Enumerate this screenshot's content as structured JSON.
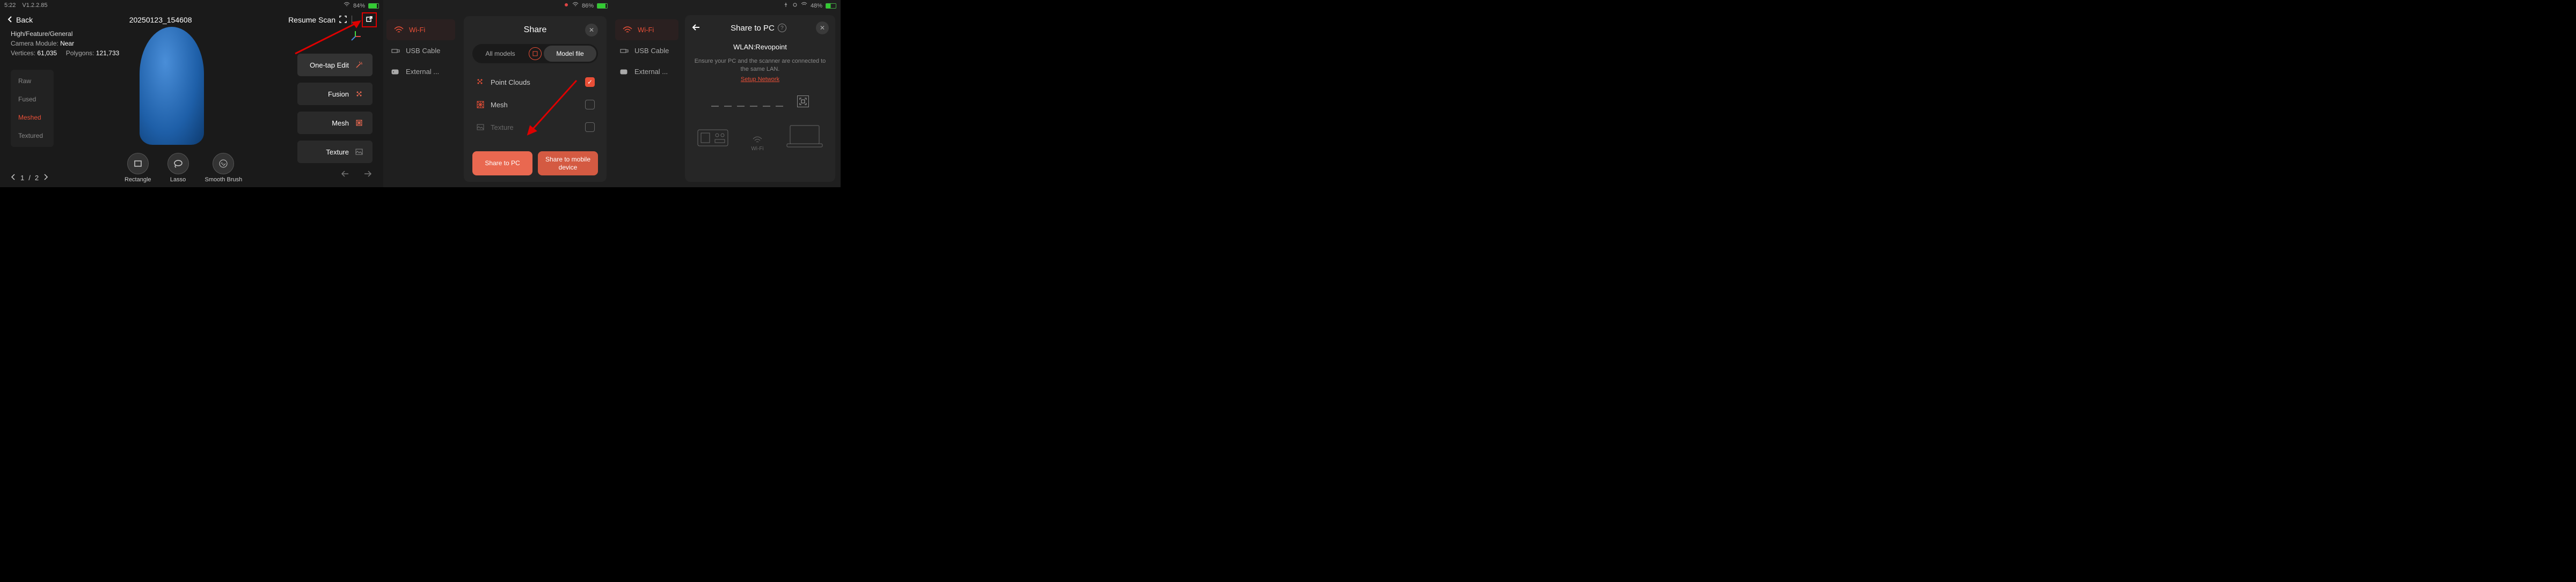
{
  "panel1": {
    "status": {
      "time": "5:22",
      "version": "V1.2.2.85",
      "battery": "84%"
    },
    "back": "Back",
    "title": "20250123_154608",
    "resume_scan": "Resume Scan",
    "info": {
      "tags": "High/Feature/General",
      "camera_label": "Camera Module:",
      "camera_value": "Near",
      "vertices_label": "Vertices:",
      "vertices_value": "61,035",
      "polygons_label": "Polygons:",
      "polygons_value": "121,733"
    },
    "modes": [
      "Raw",
      "Fused",
      "Meshed",
      "Textured"
    ],
    "mode_active_index": 2,
    "page": {
      "current": "1",
      "total": "2"
    },
    "tools": [
      "Rectangle",
      "Lasso",
      "Smooth Brush"
    ],
    "actions": {
      "onetap": "One-tap Edit",
      "fusion": "Fusion",
      "mesh": "Mesh",
      "texture": "Texture"
    }
  },
  "panel2": {
    "status": {
      "battery": "86%"
    },
    "sidebar": [
      "Wi-Fi",
      "USB Cable",
      "External ..."
    ],
    "share_title": "Share",
    "toggle": {
      "left": "All models",
      "right": "Model file"
    },
    "files": [
      {
        "name": "Point Clouds",
        "checked": true,
        "dim": false
      },
      {
        "name": "Mesh",
        "checked": false,
        "dim": false
      },
      {
        "name": "Texture",
        "checked": false,
        "dim": true
      }
    ],
    "btn_pc": "Share to PC",
    "btn_mobile": "Share to mobile device"
  },
  "panel3": {
    "status": {
      "battery": "48%"
    },
    "sidebar": [
      "Wi-Fi",
      "USB Cable",
      "External ..."
    ],
    "title": "Share to PC",
    "wlan": "WLAN:Revopoint",
    "instruct": "Ensure your PC and the scanner are connected to the same LAN.",
    "setup": "Setup Network",
    "wifi_label": "Wi-Fi"
  }
}
